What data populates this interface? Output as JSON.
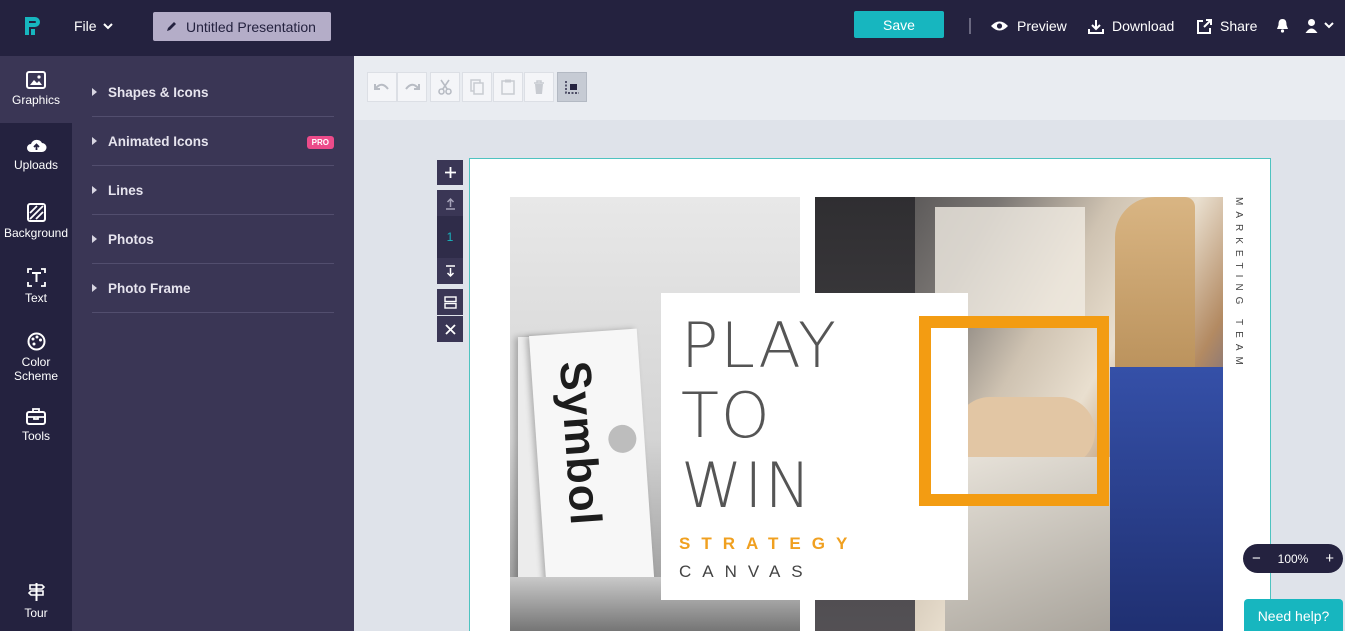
{
  "topbar": {
    "file_label": "File",
    "presentation_title": "Untitled Presentation",
    "save_label": "Save",
    "preview_label": "Preview",
    "download_label": "Download",
    "share_label": "Share"
  },
  "rail": {
    "items": [
      {
        "label": "Graphics",
        "icon": "image-icon"
      },
      {
        "label": "Uploads",
        "icon": "cloud-upload-icon"
      },
      {
        "label": "Background",
        "icon": "background-hatch-icon"
      },
      {
        "label": "Text",
        "icon": "text-icon"
      },
      {
        "label": "Color Scheme",
        "icon": "palette-icon"
      },
      {
        "label": "Tools",
        "icon": "toolbox-icon"
      }
    ],
    "tour_label": "Tour"
  },
  "panel": {
    "items": [
      {
        "label": "Shapes & Icons"
      },
      {
        "label": "Animated Icons",
        "badge": "PRO"
      },
      {
        "label": "Lines"
      },
      {
        "label": "Photos"
      },
      {
        "label": "Photo Frame"
      }
    ]
  },
  "slide_controls": {
    "page_number": "1"
  },
  "slide": {
    "headline_1": "PLAY",
    "headline_2": "TO",
    "headline_3": "WIN",
    "sub_1": "STRATEGY",
    "sub_2": "CANVAS",
    "vertical_text": "MARKETING TEAM",
    "book_text": "Symbol"
  },
  "zoom": {
    "minus": "−",
    "value": "100%",
    "plus": "+"
  },
  "help_label": "Need help?",
  "colors": {
    "topbar": "#24223f",
    "panel": "#3a3655",
    "accent": "#17b6bf",
    "frame_orange": "#f39c12",
    "pro_badge": "#ec4b8a"
  }
}
